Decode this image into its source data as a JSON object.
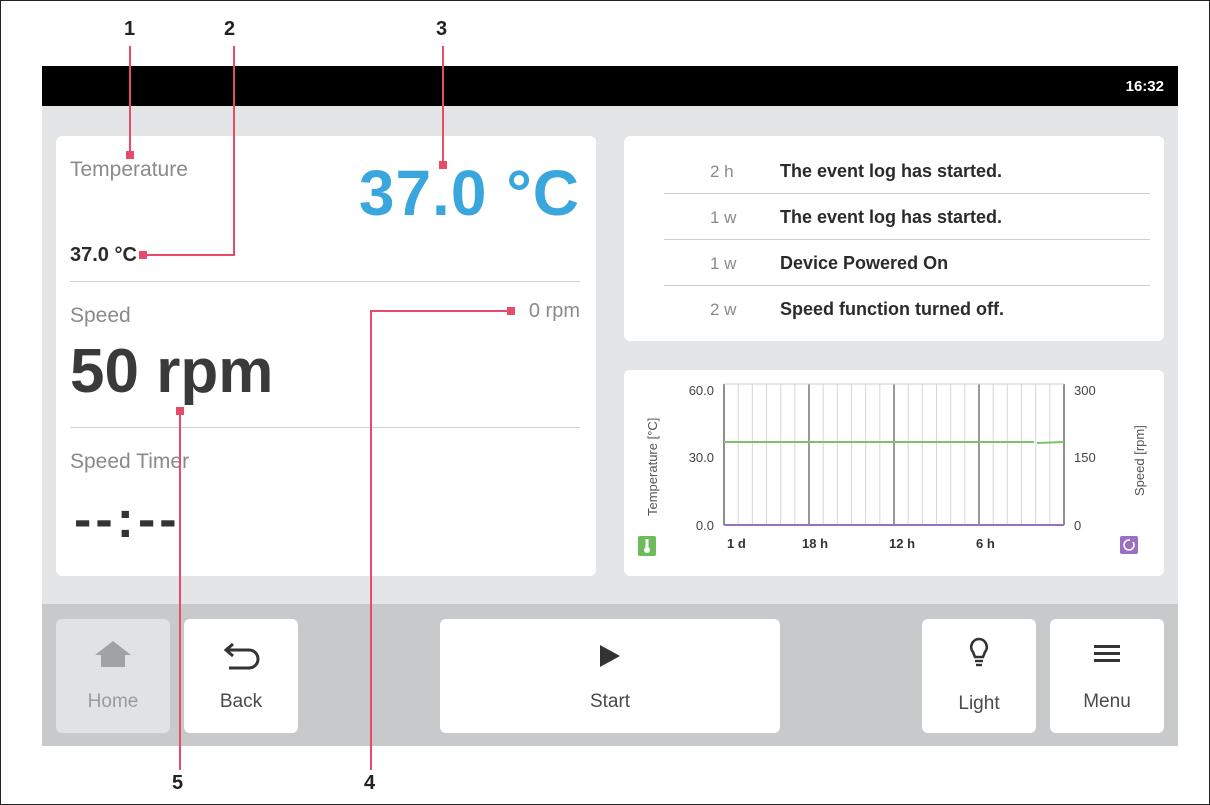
{
  "callouts": [
    "1",
    "2",
    "3",
    "4",
    "5"
  ],
  "status": {
    "time": "16:32"
  },
  "colors": {
    "accent": "#39a6de",
    "temperature_line": "#7ac36a",
    "speed_line": "#9b6fc0",
    "callout": "#e84a6a"
  },
  "temperature": {
    "label": "Temperature",
    "actual": "37.0 °C",
    "setpoint": "37.0 °C"
  },
  "speed": {
    "label": "Speed",
    "actual": "50 rpm",
    "setpoint": "0 rpm"
  },
  "timer": {
    "label": "Speed Timer",
    "value": "--:--"
  },
  "event_log": [
    {
      "age": "2 h",
      "message": "The event log has started."
    },
    {
      "age": "1 w",
      "message": "The event log has started."
    },
    {
      "age": "1 w",
      "message": "Device Powered On"
    },
    {
      "age": "2 w",
      "message": "Speed function turned off."
    }
  ],
  "chart": {
    "left_axis_title": "Temperature [°C]",
    "right_axis_title": "Speed [rpm]",
    "left_ticks": [
      "60.0",
      "30.0",
      "0.0"
    ],
    "right_ticks": [
      "300",
      "150",
      "0"
    ],
    "x_ticks": [
      "1 d",
      "18 h",
      "12 h",
      "6 h"
    ],
    "temperature_icon": "thermometer-icon",
    "speed_icon": "rotate-icon"
  },
  "buttons": {
    "home": {
      "label": "Home",
      "icon": "home-icon",
      "enabled": false
    },
    "back": {
      "label": "Back",
      "icon": "back-arrow-icon"
    },
    "start": {
      "label": "Start",
      "icon": "play-icon"
    },
    "light": {
      "label": "Light",
      "icon": "lightbulb-icon"
    },
    "menu": {
      "label": "Menu",
      "icon": "hamburger-menu-icon"
    }
  }
}
